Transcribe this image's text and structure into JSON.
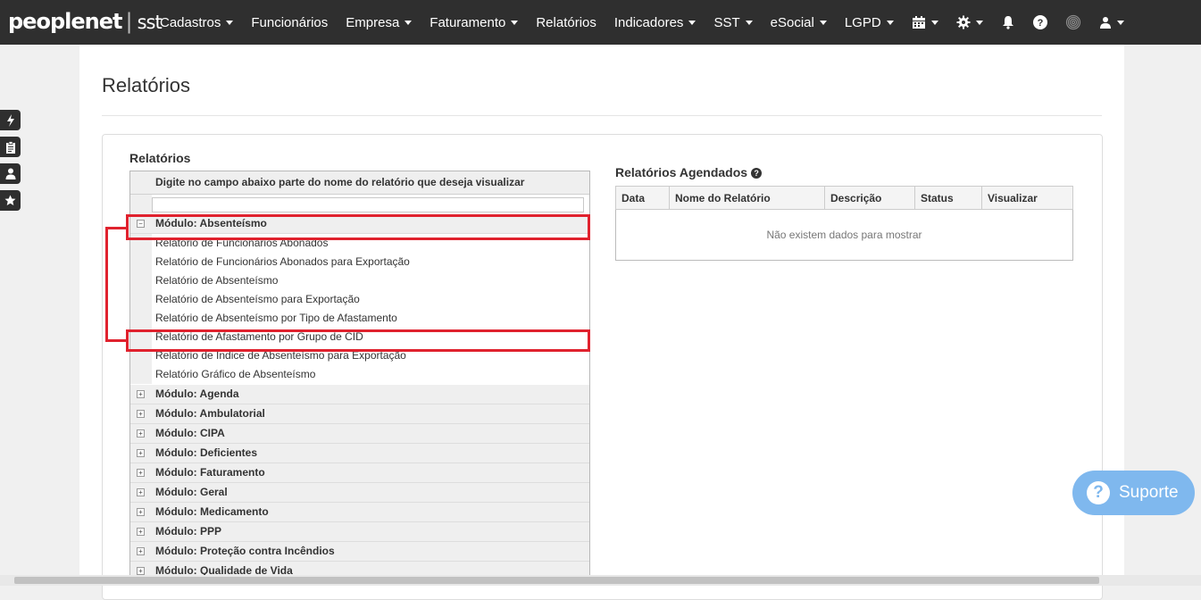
{
  "brand": {
    "name": "peoplenet",
    "product": "sst"
  },
  "nav": {
    "items": [
      {
        "label": "Cadastros",
        "dropdown": true
      },
      {
        "label": "Funcionários",
        "dropdown": false
      },
      {
        "label": "Empresa",
        "dropdown": true
      },
      {
        "label": "Faturamento",
        "dropdown": true
      },
      {
        "label": "Relatórios",
        "dropdown": false
      },
      {
        "label": "Indicadores",
        "dropdown": true
      },
      {
        "label": "SST",
        "dropdown": true
      },
      {
        "label": "eSocial",
        "dropdown": true
      },
      {
        "label": "LGPD",
        "dropdown": true
      }
    ],
    "icons": [
      "calendar-icon",
      "gear-icon",
      "bell-icon",
      "question-icon",
      "fingerprint-icon",
      "user-icon"
    ]
  },
  "sidebar": {
    "icons": [
      "bolt-icon",
      "clipboard-icon",
      "user-icon",
      "star-icon"
    ]
  },
  "page": {
    "title": "Relatórios"
  },
  "reports": {
    "label": "Relatórios",
    "header": "Digite no campo abaixo parte do nome do relatório que deseja visualizar",
    "search_value": "",
    "groups": [
      {
        "label": "Módulo: Absenteísmo",
        "expanded": true,
        "items": [
          "Relatório de Funcionários Abonados",
          "Relatório de Funcionários Abonados para Exportação",
          "Relatório de Absenteísmo",
          "Relatório de Absenteísmo para Exportação",
          "Relatório de Absenteísmo por Tipo de Afastamento",
          "Relatório de Afastamento por Grupo de CID",
          "Relatório de Índice de Absenteísmo para Exportação",
          "Relatório Gráfico de Absenteísmo"
        ]
      },
      {
        "label": "Módulo: Agenda",
        "expanded": false
      },
      {
        "label": "Módulo: Ambulatorial",
        "expanded": false
      },
      {
        "label": "Módulo: CIPA",
        "expanded": false
      },
      {
        "label": "Módulo: Deficientes",
        "expanded": false
      },
      {
        "label": "Módulo: Faturamento",
        "expanded": false
      },
      {
        "label": "Módulo: Geral",
        "expanded": false
      },
      {
        "label": "Módulo: Medicamento",
        "expanded": false
      },
      {
        "label": "Módulo: PPP",
        "expanded": false
      },
      {
        "label": "Módulo: Proteção contra Incêndios",
        "expanded": false
      },
      {
        "label": "Módulo: Qualidade de Vida",
        "expanded": false
      }
    ]
  },
  "scheduled": {
    "title": "Relatórios Agendados",
    "columns": [
      "Data",
      "Nome do Relatório",
      "Descrição",
      "Status",
      "Visualizar"
    ],
    "empty_text": "Não existem dados para mostrar"
  },
  "support": {
    "label": "Suporte"
  },
  "colors": {
    "topbar": "#2f2f2f",
    "highlight": "#e0222e",
    "support": "#7fb8ee"
  }
}
